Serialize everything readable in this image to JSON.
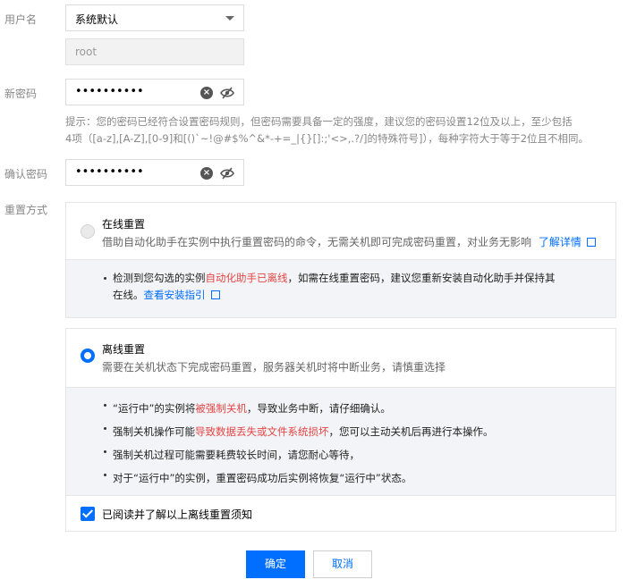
{
  "form": {
    "username_label": "用户名",
    "username_select": "系统默认",
    "username_value": "root",
    "new_password_label": "新密码",
    "new_password_mask": "••••••••••",
    "hint_line1": "提示：您的密码已经符合设置密码规则，但密码需要具备一定的强度，建议您的密码设置12位及以上，至少包括",
    "hint_line2": "4项（[a-z],[A-Z],[0-9]和[()`~!@#$%^&*-+=_|{}[]:;'<>,.?/]的特殊符号]），每种字符大于等于2位且不相同。",
    "confirm_password_label": "确认密码",
    "confirm_password_mask": "••••••••••",
    "reset_method_label": "重置方式"
  },
  "online": {
    "title": "在线重置",
    "desc": "借助自动化助手在实例中执行重置密码的命令，无需关机即可完成密码重置，对业务无影响",
    "link": "了解详情",
    "notice_pre": "检测到您勾选的实例",
    "notice_red": "自动化助手已离线",
    "notice_post": "，如需在线重置密码，建议您重新安装自动化助手并保持其",
    "notice_line2": "在线。",
    "notice_link": "查看安装指引"
  },
  "offline": {
    "title": "离线重置",
    "desc": "需要在关机状态下完成密码重置，服务器关机时将中断业务，请慎重选择",
    "b1_pre": "“运行中”的实例将",
    "b1_red": "被强制关机",
    "b1_post": "，导致业务中断，请仔细确认。",
    "b2_pre": "强制关机操作可能",
    "b2_red": "导致数据丢失或文件系统损坏",
    "b2_post": "，您可以主动关机后再进行本操作。",
    "b3": "强制关机过程可能需要耗费较长时间，请您耐心等待，",
    "b4": "对于“运行中”的实例，重置密码成功后实例将恢复“运行中”状态。",
    "ack": "已阅读并了解以上离线重置须知"
  },
  "buttons": {
    "confirm": "确定",
    "cancel": "取消"
  },
  "colors": {
    "primary": "#006eff",
    "warning_red": "#e54545"
  }
}
